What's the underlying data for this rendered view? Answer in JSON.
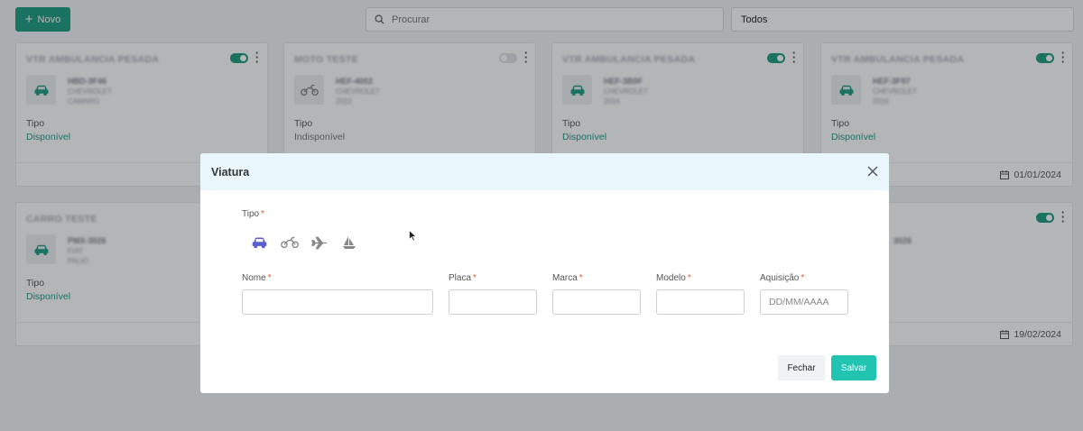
{
  "toolbar": {
    "new_label": "Novo",
    "search_placeholder": "Procurar",
    "filter_value": "Todos"
  },
  "cards": [
    {
      "title": "VTR AMBULANCIA PESADA",
      "plate": "HBD-3F46",
      "brand": "CHEVROLET",
      "model": "CAMARO",
      "type_label": "Tipo",
      "status": "Disponível",
      "active": true,
      "date": ""
    },
    {
      "title": "MOTO TESTE",
      "plate": "HEF-4002",
      "brand": "CHEVROLET",
      "model": "2022",
      "type_label": "Tipo",
      "status": "Indisponível",
      "active": false,
      "date": ""
    },
    {
      "title": "VTR AMBULANCIA PESADA",
      "plate": "HEF-3B0F",
      "brand": "CHEVROLET",
      "model": "2016",
      "type_label": "Tipo",
      "status": "Disponível",
      "active": true,
      "date": ""
    },
    {
      "title": "VTR AMBULANCIA PESADA",
      "plate": "HEF-3F97",
      "brand": "CHEVROLET",
      "model": "2016",
      "type_label": "Tipo",
      "status": "Disponível",
      "active": true,
      "date": "01/01/2024"
    },
    {
      "title": "CARRO TESTE",
      "plate": "PMX-3026",
      "brand": "FIAT",
      "model": "PALIO",
      "type_label": "Tipo",
      "status": "Disponível",
      "active": true,
      "date": ""
    },
    {
      "title": "",
      "plate": "3026",
      "brand": "",
      "model": "",
      "type_label": "",
      "status": "",
      "active": true,
      "date": "19/02/2024"
    }
  ],
  "modal": {
    "title": "Viatura",
    "tipo_label": "Tipo",
    "required_mark": "*",
    "vehicle_types": [
      "car-icon",
      "motorcycle-icon",
      "plane-icon",
      "boat-icon"
    ],
    "selected_type": "car-icon",
    "fields": {
      "nome": {
        "label": "Nome",
        "value": "",
        "placeholder": ""
      },
      "placa": {
        "label": "Placa",
        "value": "",
        "placeholder": ""
      },
      "marca": {
        "label": "Marca",
        "value": "",
        "placeholder": ""
      },
      "modelo": {
        "label": "Modelo",
        "value": "",
        "placeholder": ""
      },
      "aquisicao": {
        "label": "Aquisição",
        "value": "",
        "placeholder": "DD/MM/AAAA"
      }
    },
    "close_label": "Fechar",
    "save_label": "Salvar"
  },
  "colors": {
    "primary_green": "#1e9c7f",
    "save_teal": "#21c4b1",
    "selected_icon": "#5a5fd1",
    "required": "#e8572b",
    "modal_header": "#e9f6fb"
  }
}
